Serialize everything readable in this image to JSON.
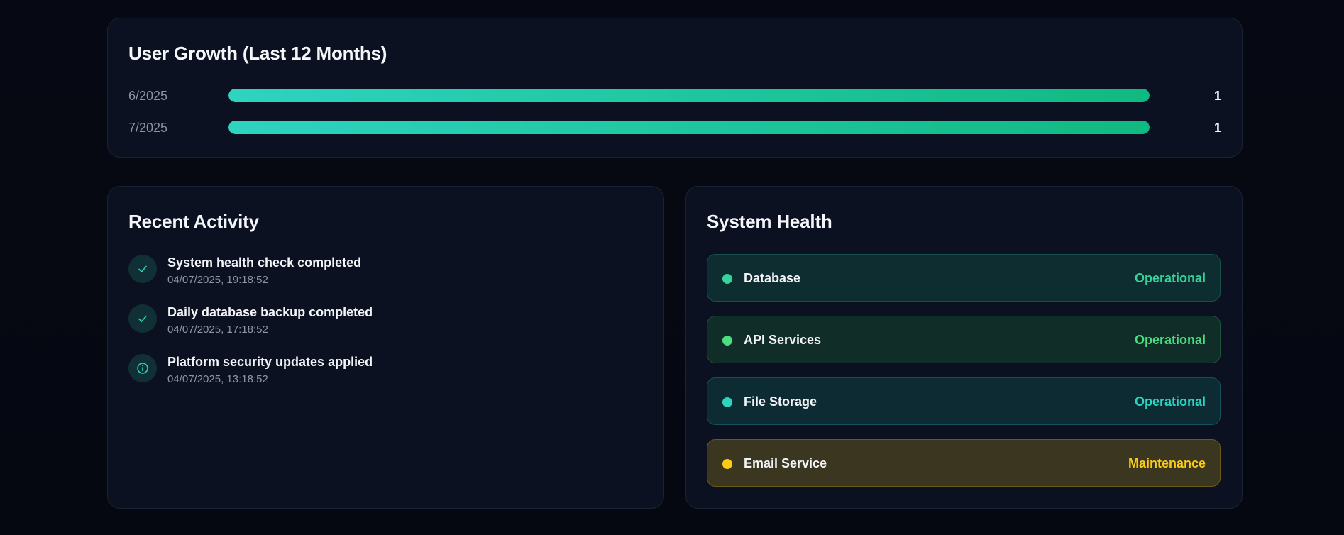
{
  "growth": {
    "title": "User Growth (Last 12 Months)",
    "rows": [
      {
        "label": "6/2025",
        "value": "1",
        "fraction": 1.0
      },
      {
        "label": "7/2025",
        "value": "1",
        "fraction": 1.0
      }
    ],
    "bar_color_start": "#2dd4bf",
    "bar_color_end": "#10b981"
  },
  "activity": {
    "title": "Recent Activity",
    "items": [
      {
        "title": "System health check completed",
        "time": "04/07/2025, 19:18:52",
        "icon": "check-icon"
      },
      {
        "title": "Daily database backup completed",
        "time": "04/07/2025, 17:18:52",
        "icon": "check-icon"
      },
      {
        "title": "Platform security updates applied",
        "time": "04/07/2025, 13:18:52",
        "icon": "info-icon"
      }
    ],
    "icon_color": "#2dd4bf"
  },
  "health": {
    "title": "System Health",
    "items": [
      {
        "name": "Database",
        "status": "Operational",
        "color": "#34d399"
      },
      {
        "name": "API Services",
        "status": "Operational",
        "color": "#4ade80"
      },
      {
        "name": "File Storage",
        "status": "Operational",
        "color": "#2dd4bf"
      },
      {
        "name": "Email Service",
        "status": "Maintenance",
        "color": "#facc15"
      }
    ]
  }
}
